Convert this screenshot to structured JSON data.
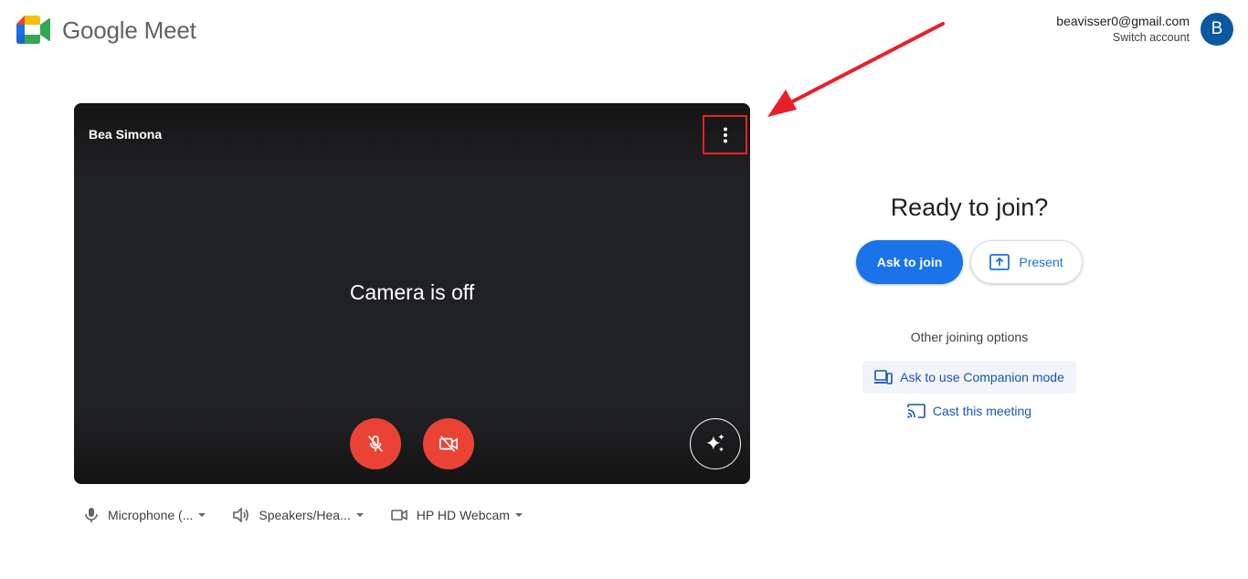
{
  "header": {
    "app_title": "Google Meet",
    "account_email": "beavisser0@gmail.com",
    "switch_account_label": "Switch account",
    "avatar_letter": "B"
  },
  "preview": {
    "self_name": "Bea Simona",
    "status_text": "Camera is off",
    "more_options_icon": "more-vert-icon",
    "microphone_state": "muted",
    "camera_state": "off"
  },
  "devices": [
    {
      "label": "Microphone (...",
      "icon": "microphone-icon"
    },
    {
      "label": "Speakers/Hea...",
      "icon": "speaker-icon"
    },
    {
      "label": "HP HD Webcam",
      "icon": "webcam-icon"
    }
  ],
  "join_panel": {
    "heading": "Ready to join?",
    "ask_to_join_label": "Ask to join",
    "present_label": "Present",
    "other_options_label": "Other joining options",
    "companion_label": "Ask to use Companion mode",
    "cast_label": "Cast this meeting"
  },
  "colors": {
    "accent": "#1a73e8",
    "danger": "#ea4335",
    "preview_bg": "#202124",
    "annotation": "#e8202a"
  }
}
